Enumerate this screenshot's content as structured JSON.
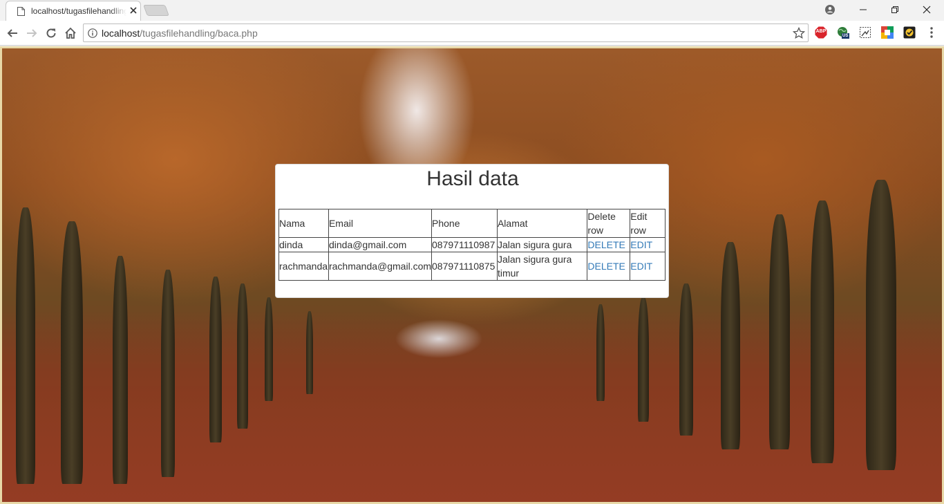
{
  "browser": {
    "tab_title": "localhost/tugasfilehandling/baca.php",
    "url_host": "localhost",
    "url_path": "/tugasfilehandling/baca.php",
    "extensions": [
      "abp-icon",
      "globe-us-icon",
      "screenshot-icon",
      "color-picker-icon",
      "check-icon"
    ],
    "abp_label": "ABP",
    "globe_badge": "US"
  },
  "page": {
    "title": "Hasil data",
    "table": {
      "headers": [
        "Nama",
        "Email",
        "Phone",
        "Alamat",
        "Delete row",
        "Edit row"
      ],
      "rows": [
        {
          "nama": "dinda",
          "email": "dinda@gmail.com",
          "phone": "087971110987",
          "alamat": "Jalan sigura gura",
          "delete": "DELETE",
          "edit": "EDIT"
        },
        {
          "nama": "rachmanda",
          "email": "rachmanda@gmail.com",
          "phone": "087971110875",
          "alamat": "Jalan sigura gura timur",
          "delete": "DELETE",
          "edit": "EDIT"
        }
      ]
    },
    "link_color": "#337ab7"
  }
}
